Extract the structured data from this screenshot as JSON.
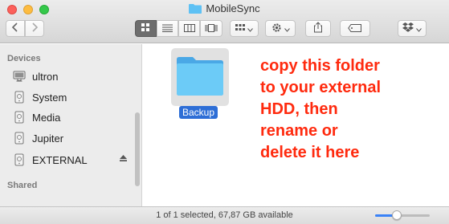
{
  "window": {
    "title": "MobileSync"
  },
  "toolbar": {
    "back_icon": "chevron-left-icon",
    "forward_icon": "chevron-right-icon",
    "view_modes": [
      "icon-view",
      "list-view",
      "column-view",
      "cover-flow-view"
    ],
    "active_view": "icon-view",
    "arrange_icon": "grid-icon",
    "action_icon": "gear-icon",
    "share_icon": "share-icon",
    "tags_icon": "tag-icon",
    "dropbox_icon": "dropbox-icon"
  },
  "sidebar": {
    "devices_heading": "Devices",
    "items": [
      {
        "label": "ultron",
        "icon": "computer-icon"
      },
      {
        "label": "System",
        "icon": "drive-icon"
      },
      {
        "label": "Media",
        "icon": "drive-icon"
      },
      {
        "label": "Jupiter",
        "icon": "drive-icon"
      },
      {
        "label": "EXTERNAL",
        "icon": "drive-icon",
        "ejectable": true
      }
    ],
    "shared_heading": "Shared"
  },
  "content": {
    "folder": {
      "name": "Backup",
      "selected": true
    },
    "annotation": "copy this folder\nto your external\nHDD, then\nrename or\ndelete it here"
  },
  "status": {
    "text": "1 of 1 selected, 67,87 GB available",
    "zoom_level": 0.4
  },
  "colors": {
    "annotation": "#ff2a0e",
    "selection": "#2d6ed6",
    "folder": "#5ec1f4"
  }
}
